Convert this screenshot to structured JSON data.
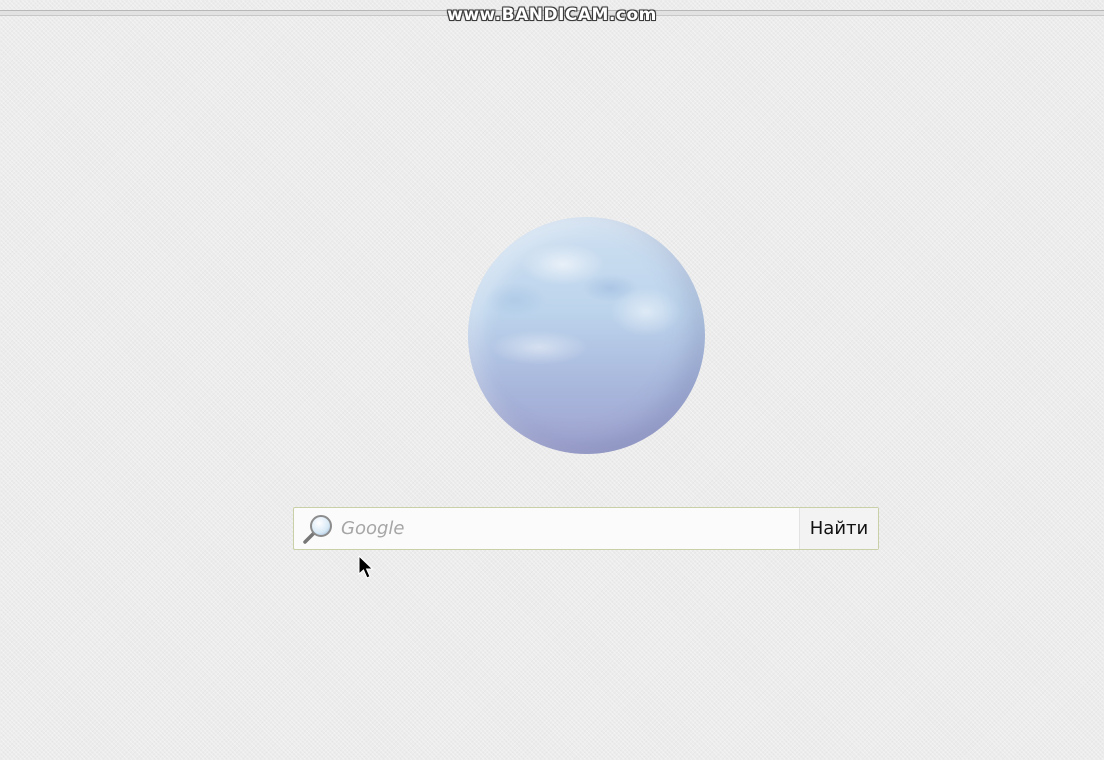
{
  "watermark": {
    "text": "www.BANDICAM.com"
  },
  "search": {
    "placeholder": "Google",
    "value": "",
    "button_label": "Найти",
    "icon": "magnifier-icon"
  },
  "colors": {
    "background": "#ececec",
    "search_border": "#c9d0a8",
    "globe_top": "#cfe0f1",
    "globe_bottom": "#9fa3cf"
  }
}
